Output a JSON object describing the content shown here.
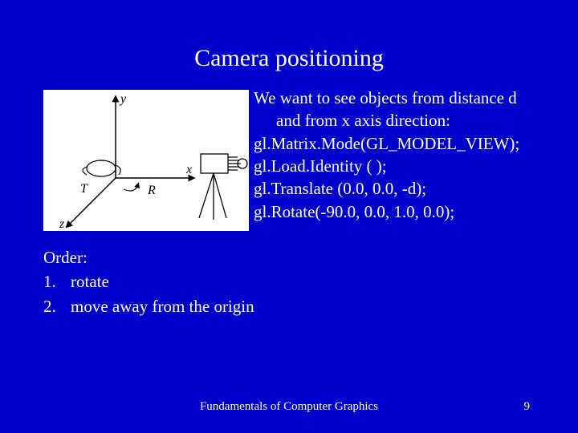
{
  "title": "Camera positioning",
  "right": {
    "intro_l1": "We want to see objects from distance d",
    "intro_l2": "and from x axis direction:",
    "code1": "gl.Matrix.Mode(GL_MODEL_VIEW);",
    "code2": "gl.Load.Identity ( );",
    "code3": "gl.Translate (0.0, 0.0, -d);",
    "code4": "gl.Rotate(-90.0, 0.0, 1.0, 0.0);"
  },
  "order": {
    "heading": "Order:",
    "item1_num": "1.",
    "item1_text": "rotate",
    "item2_num": "2.",
    "item2_text": "move away from the origin"
  },
  "footer": {
    "text": "Fundamentals of Computer Graphics",
    "page": "9"
  },
  "diagram": {
    "y_label": "y",
    "x_label": "x",
    "z_label": "z",
    "T_label": "T",
    "R_label": "R"
  }
}
